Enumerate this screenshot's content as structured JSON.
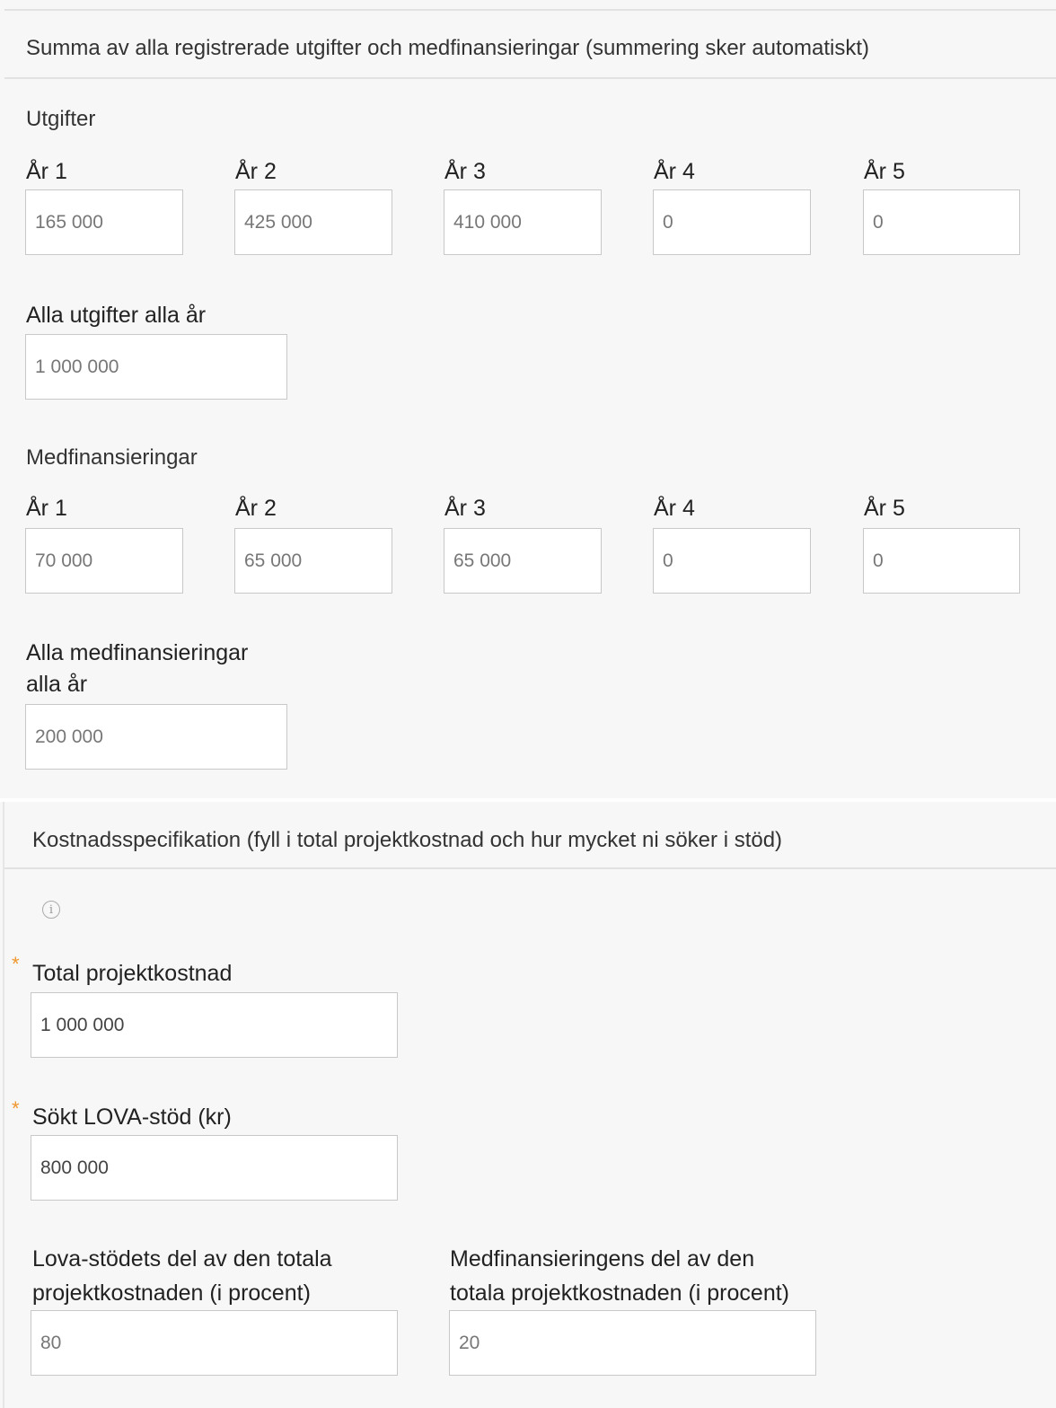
{
  "summary": {
    "header": "Summa av alla registrerade utgifter och medfinansieringar (summering sker automatiskt)",
    "expenses": {
      "title": "Utgifter",
      "years": [
        {
          "label": "År 1",
          "value": "165 000"
        },
        {
          "label": "År 2",
          "value": "425 000"
        },
        {
          "label": "År 3",
          "value": "410 000"
        },
        {
          "label": "År 4",
          "value": "0"
        },
        {
          "label": "År 5",
          "value": "0"
        }
      ],
      "total_label": "Alla utgifter alla år",
      "total_value": "1 000 000"
    },
    "cofinancing": {
      "title": "Medfinansieringar",
      "years": [
        {
          "label": "År 1",
          "value": "70 000"
        },
        {
          "label": "År 2",
          "value": "65 000"
        },
        {
          "label": "År 3",
          "value": "65 000"
        },
        {
          "label": "År 4",
          "value": "0"
        },
        {
          "label": "År 5",
          "value": "0"
        }
      ],
      "total_label_line1": "Alla medfinansieringar",
      "total_label_line2": "alla år",
      "total_value": "200 000"
    }
  },
  "cost_spec": {
    "header": "Kostnadsspecifikation (fyll i total projektkostnad och hur mycket ni söker i stöd)",
    "info_icon": "info-icon",
    "required_marker": "*",
    "total_cost_label": "Total projektkostnad",
    "total_cost_value": "1 000 000",
    "lova_label": "Sökt LOVA-stöd (kr)",
    "lova_value": "800 000",
    "lova_share_label_line1": "Lova-stödets del av den totala",
    "lova_share_label_line2": "projektkostnaden (i procent)",
    "lova_share_value": "80",
    "cofin_share_label_line1": "Medfinansieringens del av den",
    "cofin_share_label_line2": "totala projektkostnaden (i procent)",
    "cofin_share_value": "20"
  },
  "colors": {
    "background": "#f7f7f7",
    "field_border": "#c8c8c8",
    "required": "#f0962e"
  }
}
